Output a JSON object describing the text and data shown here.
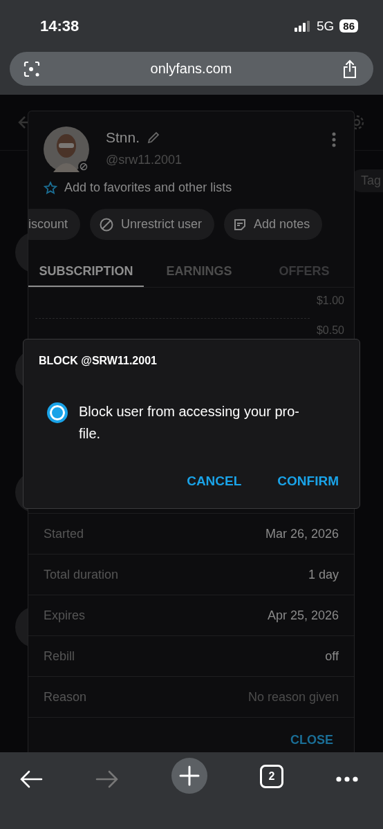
{
  "status_bar": {
    "time": "14:38",
    "network": "5G",
    "battery": "86"
  },
  "browser": {
    "url": "onlyfans.com",
    "tab_count": "2",
    "forward_disabled": true
  },
  "background": {
    "tag_chip": "Tag"
  },
  "profile_sheet": {
    "name": "Stnn.",
    "handle": "@srw11.2001",
    "blocked": true,
    "favorites_link": "Add to favorites and other lists",
    "actions": [
      {
        "label": "iscount",
        "kind": "text"
      },
      {
        "label": "Unrestrict user",
        "kind": "block"
      },
      {
        "label": "Add notes",
        "kind": "notes"
      }
    ],
    "tabs": [
      {
        "label": "SUBSCRIPTION",
        "selected": true,
        "disabled": false
      },
      {
        "label": "EARNINGS",
        "selected": false,
        "disabled": false
      },
      {
        "label": "OFFERS",
        "selected": false,
        "disabled": true
      }
    ],
    "chart_axis_labels": [
      "$1.00",
      "$0.50"
    ],
    "details": [
      {
        "label": "Started",
        "value": "Mar 26, 2026",
        "muted": false
      },
      {
        "label": "Total duration",
        "value": "1 day",
        "muted": false
      },
      {
        "label": "Expires",
        "value": "Apr 25, 2026",
        "muted": false
      },
      {
        "label": "Rebill",
        "value": "off",
        "muted": false
      },
      {
        "label": "Reason",
        "value": "No reason given",
        "muted": true
      }
    ],
    "close_button": "CLOSE"
  },
  "dialog": {
    "title": "BLOCK @SRW11.2001",
    "option": {
      "label": "Block user from accessing your pro-file.",
      "selected": true
    },
    "buttons": [
      {
        "label": "CANCEL"
      },
      {
        "label": "CONFIRM"
      }
    ]
  }
}
